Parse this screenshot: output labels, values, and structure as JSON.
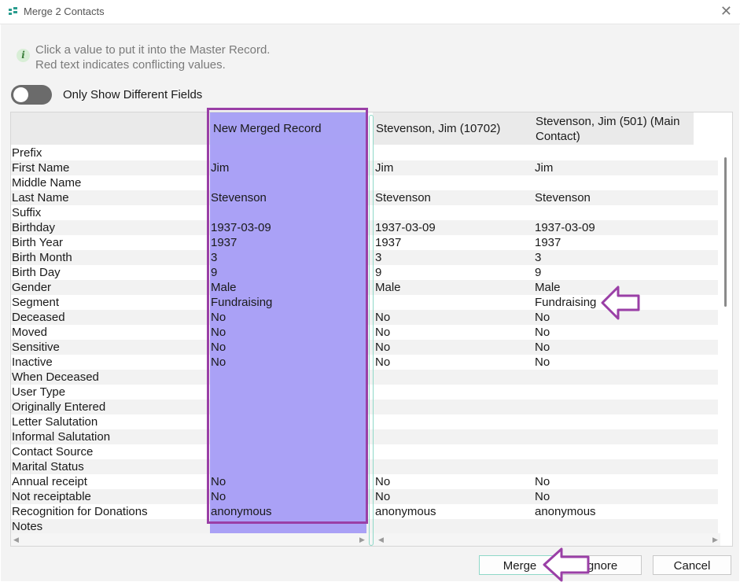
{
  "window": {
    "title": "Merge 2 Contacts"
  },
  "info": {
    "line1": "Click a value to put it into the Master Record.",
    "line2": "Red text indicates conflicting values."
  },
  "toggle": {
    "label": "Only Show Different Fields",
    "state": "off"
  },
  "columns": {
    "merged": "New Merged Record",
    "contact_a": "Stevenson, Jim (10702)",
    "contact_b": "Stevenson, Jim (501) (Main Contact)"
  },
  "rows": [
    {
      "label": "Prefix",
      "merged": "",
      "a": "",
      "b": ""
    },
    {
      "label": "First Name",
      "merged": "Jim",
      "a": "Jim",
      "b": "Jim"
    },
    {
      "label": "Middle Name",
      "merged": "",
      "a": "",
      "b": ""
    },
    {
      "label": "Last Name",
      "merged": "Stevenson",
      "a": "Stevenson",
      "b": "Stevenson"
    },
    {
      "label": "Suffix",
      "merged": "",
      "a": "",
      "b": ""
    },
    {
      "label": "Birthday",
      "merged": "1937-03-09",
      "a": "1937-03-09",
      "b": "1937-03-09"
    },
    {
      "label": "Birth Year",
      "merged": "1937",
      "a": "1937",
      "b": "1937"
    },
    {
      "label": "Birth Month",
      "merged": "3",
      "a": "3",
      "b": "3"
    },
    {
      "label": "Birth Day",
      "merged": "9",
      "a": "9",
      "b": "9"
    },
    {
      "label": "Gender",
      "merged": "Male",
      "a": "Male",
      "b": "Male"
    },
    {
      "label": "Segment",
      "merged": "Fundraising",
      "a": "",
      "b": "Fundraising"
    },
    {
      "label": "Deceased",
      "merged": "No",
      "a": "No",
      "b": "No"
    },
    {
      "label": "Moved",
      "merged": "No",
      "a": "No",
      "b": "No"
    },
    {
      "label": "Sensitive",
      "merged": "No",
      "a": "No",
      "b": "No"
    },
    {
      "label": "Inactive",
      "merged": "No",
      "a": "No",
      "b": "No"
    },
    {
      "label": "When Deceased",
      "merged": "",
      "a": "",
      "b": ""
    },
    {
      "label": "User Type",
      "merged": "",
      "a": "",
      "b": ""
    },
    {
      "label": "Originally Entered",
      "merged": "",
      "a": "",
      "b": ""
    },
    {
      "label": "Letter Salutation",
      "merged": "",
      "a": "",
      "b": ""
    },
    {
      "label": "Informal Salutation",
      "merged": "",
      "a": "",
      "b": ""
    },
    {
      "label": "Contact Source",
      "merged": "",
      "a": "",
      "b": ""
    },
    {
      "label": "Marital Status",
      "merged": "",
      "a": "",
      "b": ""
    },
    {
      "label": "Annual receipt",
      "merged": "No",
      "a": "No",
      "b": "No"
    },
    {
      "label": "Not receiptable",
      "merged": "No",
      "a": "No",
      "b": "No"
    },
    {
      "label": "Recognition for Donations",
      "merged": "anonymous",
      "a": "anonymous",
      "b": "anonymous"
    },
    {
      "label": "Notes",
      "merged": "",
      "a": "",
      "b": ""
    }
  ],
  "buttons": {
    "merge": "Merge",
    "ignore": "Ignore",
    "cancel": "Cancel"
  },
  "colors": {
    "merged_column": "#aaa1f6",
    "highlight": "#9a3fa6",
    "stripe": "#f2f2f2",
    "accent": "#8fd8c8"
  }
}
